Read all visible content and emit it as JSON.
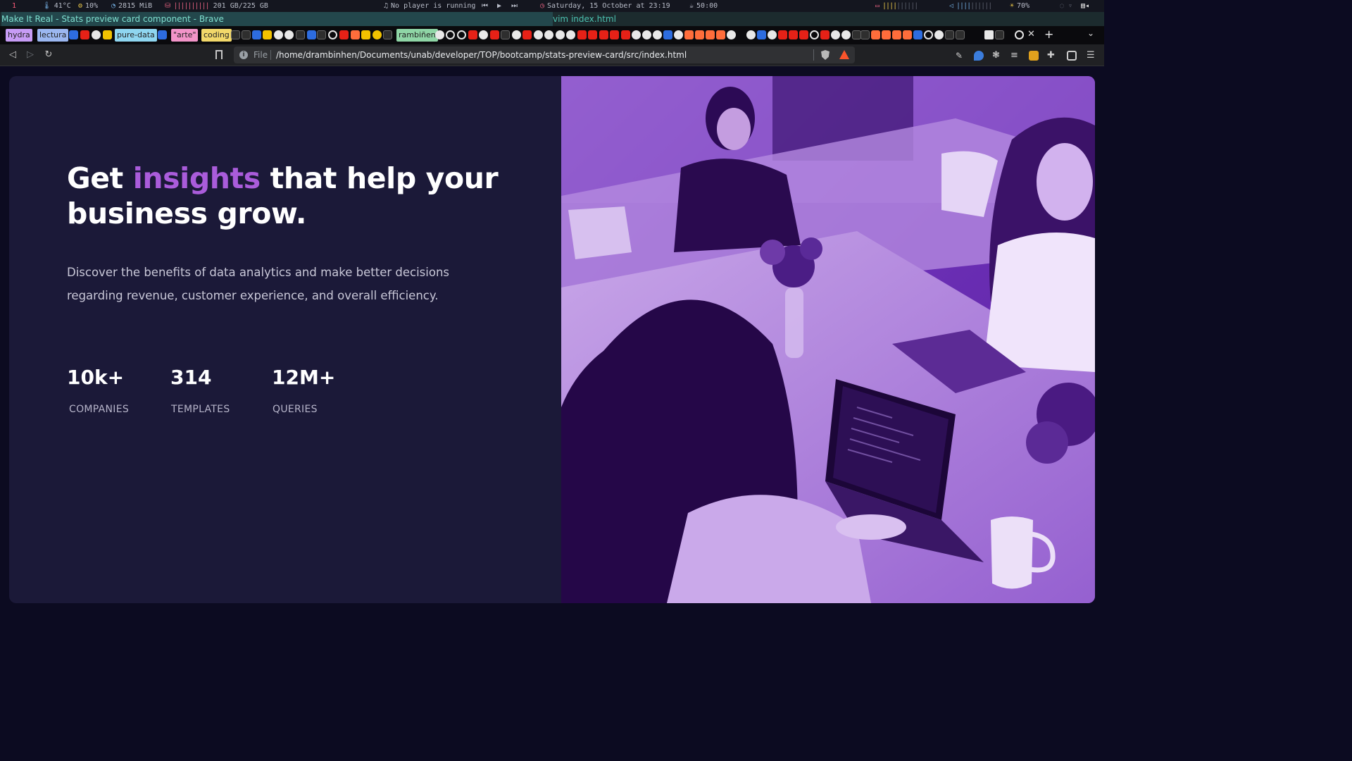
{
  "statusbar": {
    "workspace": "1",
    "temperature": "41°C",
    "cpu": "10%",
    "memory": "2815 MiB",
    "disk": "201 GB/225 GB",
    "player": "No player is running",
    "datetime": "Saturday, 15 October at 23:19",
    "timer": "50:00",
    "brightness": "70%"
  },
  "window": {
    "title": "Make It Real - Stats preview card component - Brave",
    "secondary_title": "vim index.html"
  },
  "tab_groups": [
    {
      "label": "hydra",
      "color": "#c79cf5"
    },
    {
      "label": "lectura",
      "color": "#9bb7f0"
    },
    {
      "label": "pure-data",
      "color": "#8fd6f0"
    },
    {
      "label": "\"arte\"",
      "color": "#f294c8"
    },
    {
      "label": "coding",
      "color": "#f2d86a"
    },
    {
      "label": "rambiñen",
      "color": "#8fd6a6"
    }
  ],
  "nav": {
    "scheme_label": "File",
    "url": "/home/drambinhen/Documents/unab/developer/TOP/bootcamp/stats-preview-card/src/index.html"
  },
  "card": {
    "headline_before": "Get ",
    "headline_accent": "insights",
    "headline_after": " that help your business grow.",
    "description": "Discover the benefits of data analytics and make better decisions regarding revenue, customer experience, and overall efficiency.",
    "stats": [
      {
        "value": "10k+",
        "label": "COMPANIES"
      },
      {
        "value": "314",
        "label": "TEMPLATES"
      },
      {
        "value": "12M+",
        "label": "QUERIES"
      }
    ],
    "accent_color": "#aa5cdb",
    "background_color": "#1b1938",
    "page_background": "#0c0b21"
  }
}
